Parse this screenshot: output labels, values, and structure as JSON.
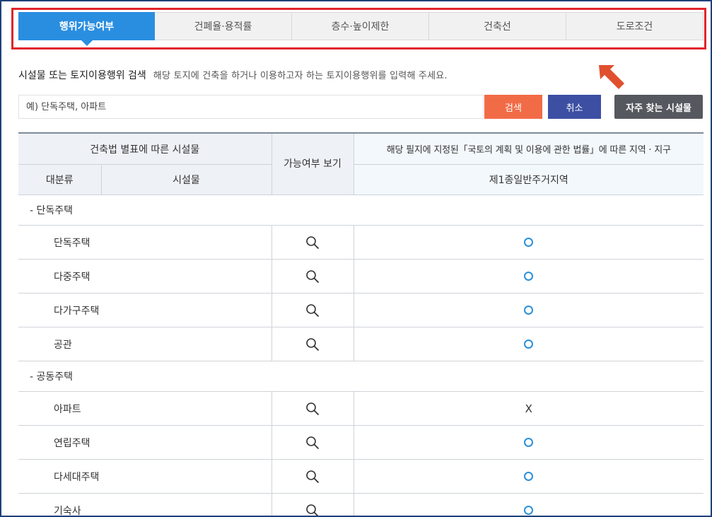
{
  "tabs": [
    {
      "label": "행위가능여부",
      "active": true
    },
    {
      "label": "건폐율·용적률",
      "active": false
    },
    {
      "label": "층수·높이제한",
      "active": false
    },
    {
      "label": "건축선",
      "active": false
    },
    {
      "label": "도로조건",
      "active": false
    }
  ],
  "search": {
    "title": "시설물 또는 토지이용행위 검색",
    "description": "해당 토지에 건축을 하거나 이용하고자 하는 토지이용행위를 입력해 주세요.",
    "placeholder": "예) 단독주택, 아파트",
    "search_label": "검색",
    "cancel_label": "취소",
    "frequent_label": "자주 찾는 시설물"
  },
  "table": {
    "header_building_law": "건축법 별표에 따른 시설물",
    "header_availability": "가능여부 보기",
    "header_zone_law": "해당 필지에 지정된「국토의 계획 및 이용에 관한 법률」에 따른 지역 · 지구",
    "header_category": "대분류",
    "header_facility": "시설물",
    "header_zone_name": "제1종일반주거지역",
    "groups": [
      {
        "label": "- 단독주택",
        "items": [
          {
            "name": "단독주택",
            "status": "O"
          },
          {
            "name": "다중주택",
            "status": "O"
          },
          {
            "name": "다가구주택",
            "status": "O"
          },
          {
            "name": "공관",
            "status": "O"
          }
        ]
      },
      {
        "label": "- 공동주택",
        "items": [
          {
            "name": "아파트",
            "status": "X"
          },
          {
            "name": "연립주택",
            "status": "O"
          },
          {
            "name": "다세대주택",
            "status": "O"
          },
          {
            "name": "기숙사",
            "status": "O"
          }
        ]
      }
    ]
  },
  "colors": {
    "active_tab": "#2a8ee0",
    "highlight_border": "#e0252b",
    "search_button": "#f26b47",
    "cancel_button": "#3d4fa3",
    "frequent_button": "#55585e",
    "arrow": "#e0502e",
    "allowed_marker": "#2a90d8"
  },
  "icons": {
    "arrow": "arrow-up-left-icon",
    "view": "magnifier-icon",
    "allowed": "circle-o-icon"
  }
}
